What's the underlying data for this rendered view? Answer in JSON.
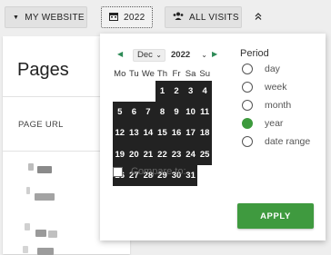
{
  "toolbar": {
    "website_label": "MY WEBSITE",
    "date_label": "2022",
    "segment_label": "ALL VISITS",
    "colors": {
      "button_bg": "#e2e2e2"
    }
  },
  "pages_card": {
    "title": "Pages",
    "column_header": "PAGE URL"
  },
  "calendar": {
    "prev_symbol": "◀",
    "next_symbol": "▶",
    "month": "Dec",
    "year": "2022",
    "weekdays": [
      "Mo",
      "Tu",
      "We",
      "Th",
      "Fr",
      "Sa",
      "Su"
    ],
    "weeks": [
      [
        "",
        "",
        "",
        "1",
        "2",
        "3",
        "4"
      ],
      [
        "5",
        "6",
        "7",
        "8",
        "9",
        "10",
        "11"
      ],
      [
        "12",
        "13",
        "14",
        "15",
        "16",
        "17",
        "18"
      ],
      [
        "19",
        "20",
        "21",
        "22",
        "23",
        "24",
        "25"
      ],
      [
        "26",
        "27",
        "28",
        "29",
        "30",
        "31",
        ""
      ]
    ],
    "selected_color": "#222222"
  },
  "period": {
    "label": "Period",
    "options": [
      "day",
      "week",
      "month",
      "year",
      "date range"
    ],
    "selected": "year",
    "accent": "#3c9a3c"
  },
  "compare": {
    "label": "Compare to:",
    "checked": false
  },
  "apply_label": "APPLY"
}
